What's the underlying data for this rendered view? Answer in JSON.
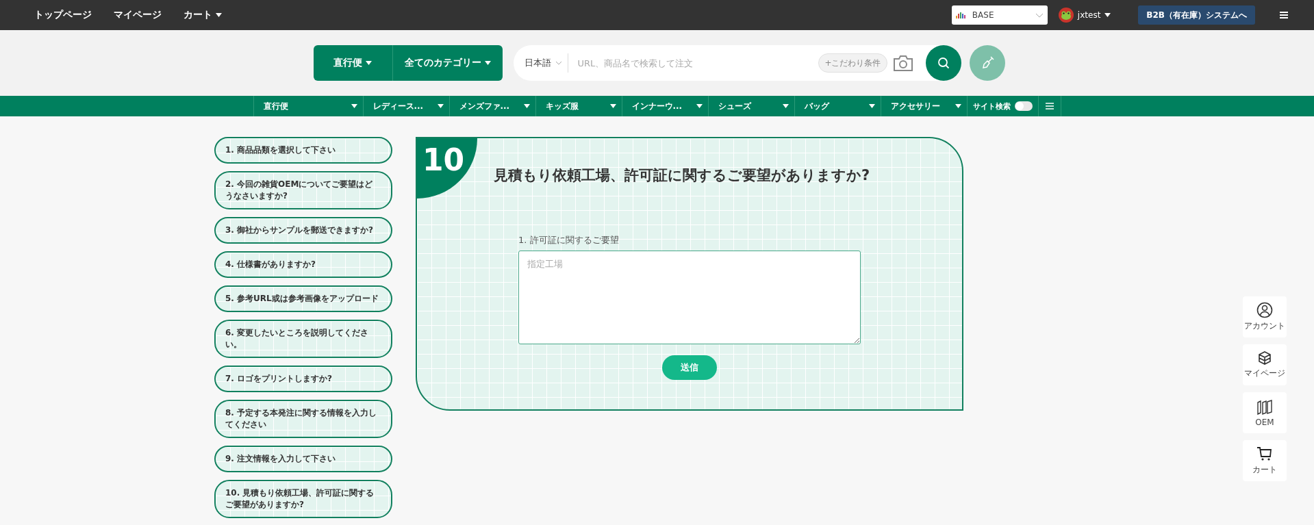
{
  "top_nav": {
    "links": [
      {
        "label": "トップページ",
        "dropdown": false
      },
      {
        "label": "マイページ",
        "dropdown": false
      },
      {
        "label": "カート",
        "dropdown": true
      }
    ],
    "store_select": {
      "value": "BASE"
    },
    "user": {
      "name": "jxtest"
    },
    "system_button": "B2B（有在庫）システムへ"
  },
  "search": {
    "shipping": "直行便",
    "category": "全てのカテゴリー",
    "language": "日本語",
    "placeholder": "URL、商品名で検索して注文",
    "filter_button": "+こだわり条件"
  },
  "category_nav": {
    "items": [
      {
        "label": "直行便"
      },
      {
        "label": "レディース..."
      },
      {
        "label": "メンズファ..."
      },
      {
        "label": "キッズ服"
      },
      {
        "label": "インナーウ..."
      },
      {
        "label": "シューズ"
      },
      {
        "label": "バッグ"
      },
      {
        "label": "アクセサリー"
      }
    ],
    "site_search": {
      "label": "サイト検索",
      "on": false
    }
  },
  "steps": [
    {
      "label": "1. 商品品類を選択して下さい"
    },
    {
      "label": "2. 今回の雑貨OEMについてご要望はどうなさいますか?"
    },
    {
      "label": "3. 御社からサンプルを郵送できますか?"
    },
    {
      "label": "4. 仕様書がありますか?"
    },
    {
      "label": "5. 参考URL或は参考画像をアップロード"
    },
    {
      "label": "6. 変更したいところを説明してください。"
    },
    {
      "label": "7. ロゴをプリントしますか?"
    },
    {
      "label": "8. 予定する本発注に関する情報を入力してください"
    },
    {
      "label": "9. 注文情報を入力して下さい"
    },
    {
      "label": "10. 見積もり依頼工場、許可証に関するご要望がありますか?"
    }
  ],
  "question": {
    "number": "10",
    "title": "見積もり依頼工場、許可証に関するご要望がありますか?",
    "field_label": "1. 許可証に関するご要望",
    "placeholder": "指定工場",
    "submit": "送信"
  },
  "side_buttons": [
    {
      "kind": "account",
      "label": "アカウント"
    },
    {
      "kind": "box",
      "label": "マイページ"
    },
    {
      "kind": "oem",
      "label": "OEM"
    },
    {
      "kind": "cart",
      "label": "カート"
    }
  ]
}
